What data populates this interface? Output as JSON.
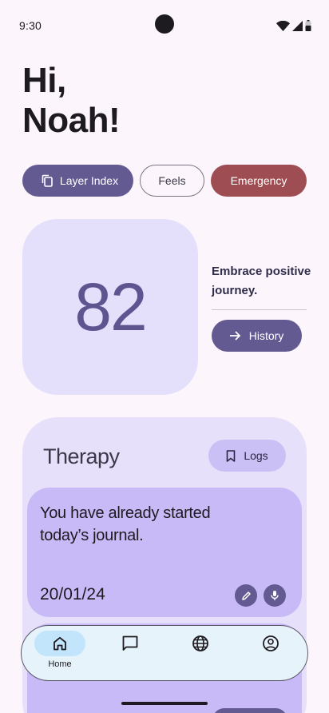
{
  "status_bar": {
    "time": "9:30"
  },
  "greeting": {
    "line1": "Hi,",
    "line2": "Noah!"
  },
  "chips": {
    "layer_index": "Layer Index",
    "feels": "Feels",
    "emergency": "Emergency"
  },
  "score": {
    "value": "82"
  },
  "tagline": "Embrace positive journey.",
  "history_button": "History",
  "therapy": {
    "title": "Therapy",
    "logs_button": "Logs",
    "journal": {
      "message": "You have already started today’s journal.",
      "date": "20/01/24"
    }
  },
  "bottom_nav": {
    "items": [
      {
        "label": "Home",
        "icon": "home-icon",
        "active": true
      },
      {
        "label": "",
        "icon": "chat-icon",
        "active": false
      },
      {
        "label": "",
        "icon": "globe-icon",
        "active": false
      },
      {
        "label": "",
        "icon": "profile-icon",
        "active": false
      }
    ]
  },
  "colors": {
    "primary": "#635a91",
    "emergency": "#9e4e53",
    "card": "#e4dffb",
    "journal_card": "#c8b9f7",
    "nav_background": "#e7f3fb",
    "nav_active": "#c2e5fb"
  }
}
